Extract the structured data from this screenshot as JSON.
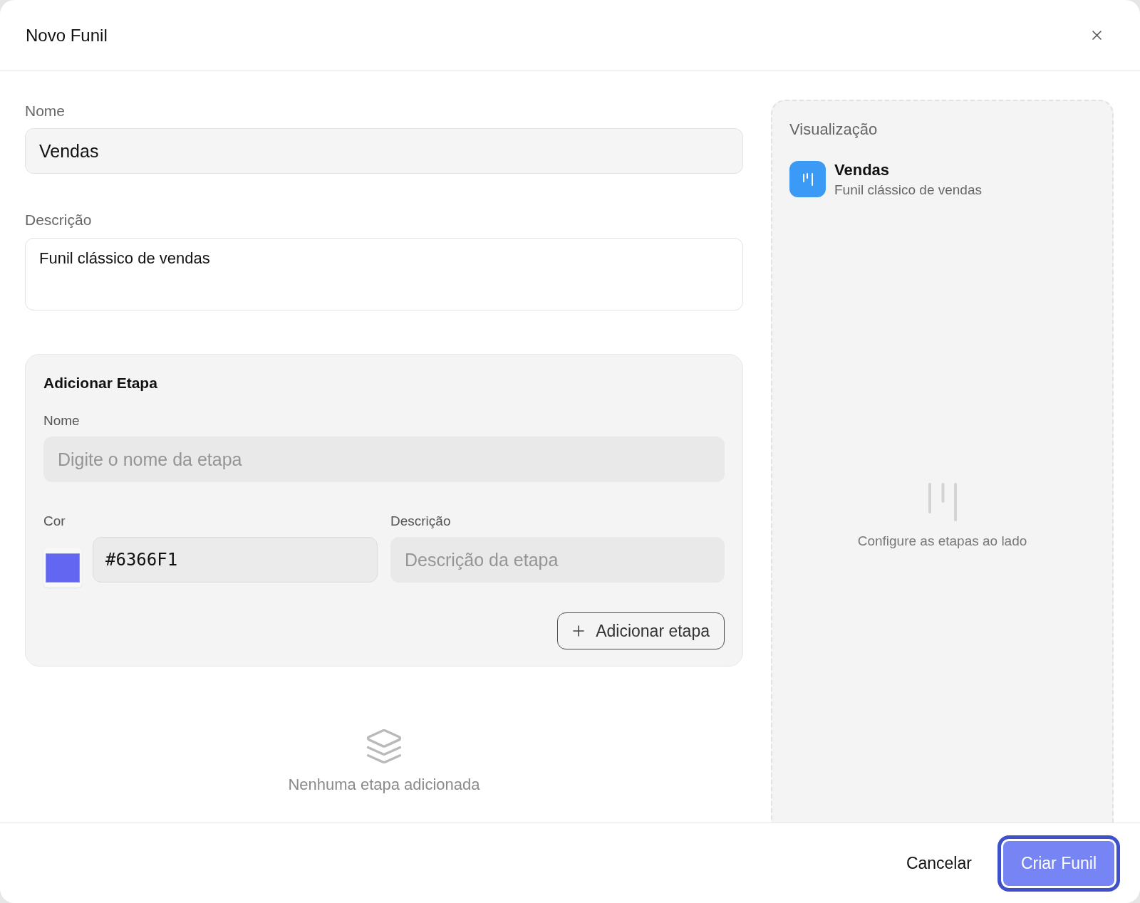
{
  "dialog": {
    "title": "Novo Funil"
  },
  "form": {
    "name": {
      "label": "Nome",
      "value": "Vendas"
    },
    "description": {
      "label": "Descrição",
      "value": "Funil clássico de vendas"
    }
  },
  "add_stage": {
    "title": "Adicionar Etapa",
    "name": {
      "label": "Nome",
      "placeholder": "Digite o nome da etapa"
    },
    "color": {
      "label": "Cor",
      "value": "#6366F1"
    },
    "description": {
      "label": "Descrição",
      "placeholder": "Descrição da etapa"
    },
    "add_button": {
      "label": "Adicionar etapa"
    }
  },
  "stages": {
    "empty_text": "Nenhuma etapa adicionada"
  },
  "preview": {
    "title": "Visualização",
    "funnel": {
      "name": "Vendas",
      "description": "Funil clássico de vendas"
    },
    "empty_text": "Configure as etapas ao lado"
  },
  "footer": {
    "buttons": [
      {
        "label": "Cancelar",
        "kind": "secondary",
        "focused": false
      },
      {
        "label": "Criar Funil",
        "kind": "primary",
        "focused": true
      }
    ]
  }
}
